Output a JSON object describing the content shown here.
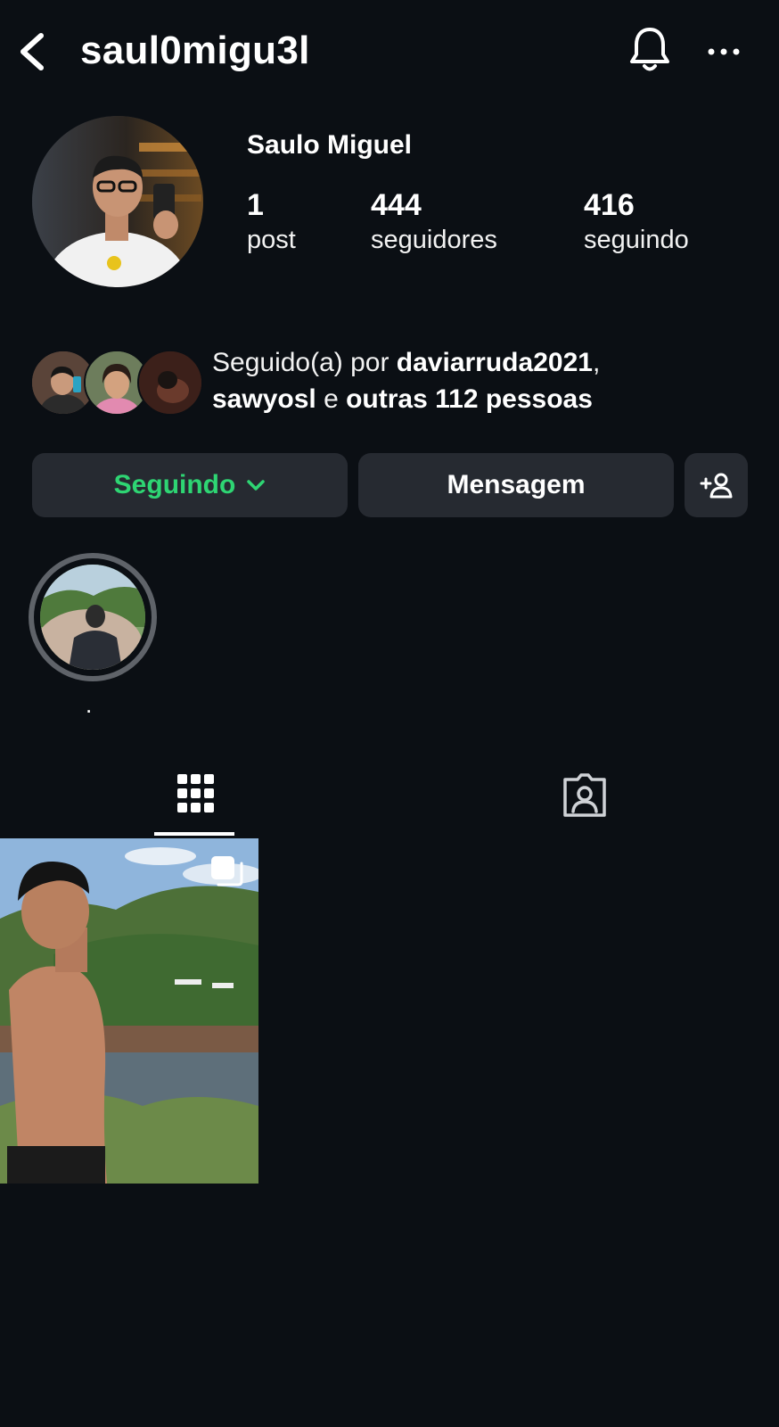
{
  "header": {
    "username": "saul0migu3l",
    "icons": {
      "back": "back-chevron-icon",
      "notifications": "bell-icon",
      "more": "more-horizontal-icon"
    }
  },
  "profile": {
    "full_name": "Saulo Miguel",
    "stats": {
      "posts": {
        "value": "1",
        "label": "post"
      },
      "followers": {
        "value": "444",
        "label": "seguidores"
      },
      "following": {
        "value": "416",
        "label": "seguindo"
      }
    }
  },
  "mutual": {
    "prefix": "Seguido(a) por ",
    "user1": "daviarruda2021",
    "comma": ",",
    "user2": "sawyosl",
    "conj": " e ",
    "others": "outras 112 pessoas"
  },
  "actions": {
    "following_label": "Seguindo",
    "message_label": "Mensagem",
    "add_user_icon": "add-user-icon"
  },
  "highlights": [
    {
      "label": "."
    }
  ],
  "tabs": [
    {
      "name": "grid",
      "icon": "grid-icon",
      "active": true
    },
    {
      "name": "tagged",
      "icon": "tagged-person-icon",
      "active": false
    }
  ],
  "colors": {
    "background": "#0b0f14",
    "button_bg": "#262a31",
    "following_green": "#2ed573",
    "highlight_ring": "#5f6369"
  }
}
